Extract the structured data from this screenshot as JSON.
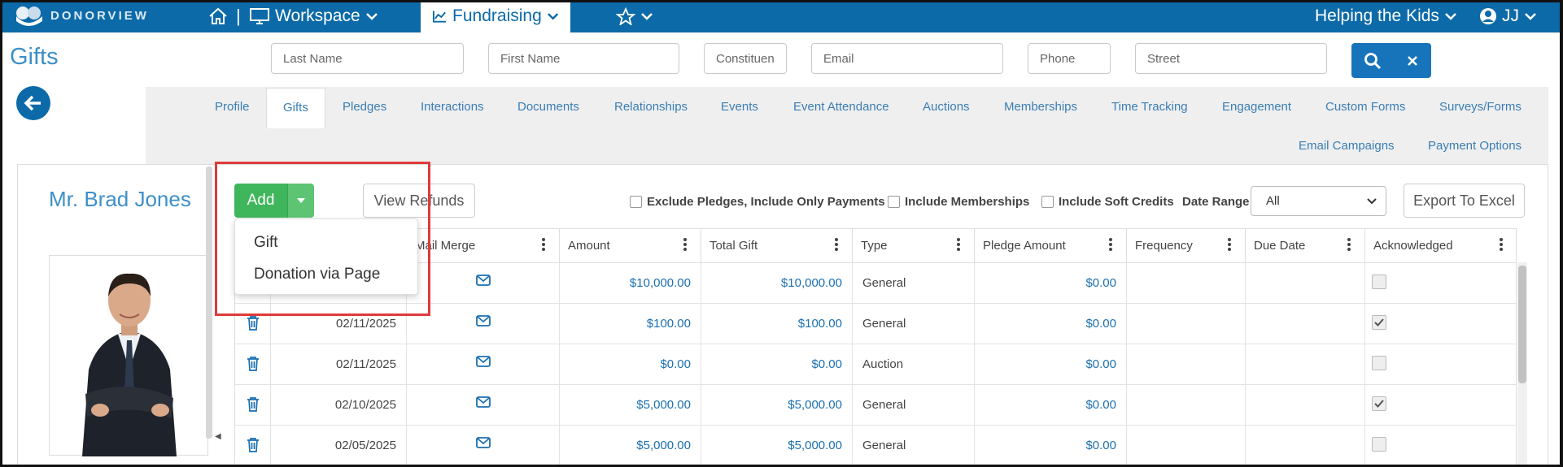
{
  "app": {
    "logo_text": "DONORVIEW"
  },
  "topbar": {
    "workspace_label": "Workspace",
    "fundraising_label": "Fundraising",
    "org_label": "Helping the Kids",
    "user_initials": "JJ",
    "separator": "|"
  },
  "page": {
    "title": "Gifts"
  },
  "search": {
    "last_name": "Last Name",
    "first_name": "First Name",
    "constituent": "Constituen",
    "email": "Email",
    "phone": "Phone",
    "street": "Street"
  },
  "tabs": {
    "profile": "Profile",
    "gifts": "Gifts",
    "pledges": "Pledges",
    "interactions": "Interactions",
    "documents": "Documents",
    "relationships": "Relationships",
    "events": "Events",
    "event_attendance": "Event Attendance",
    "auctions": "Auctions",
    "memberships": "Memberships",
    "time_tracking": "Time Tracking",
    "engagement": "Engagement",
    "custom_forms": "Custom Forms",
    "surveys_forms": "Surveys/Forms",
    "email_campaigns": "Email Campaigns",
    "payment_options": "Payment Options"
  },
  "donor": {
    "name": "Mr. Brad Jones"
  },
  "toolbar": {
    "add_label": "Add",
    "view_refunds": "View Refunds",
    "exclude_pledges": "Exclude Pledges, Include Only Payments",
    "include_memberships": "Include Memberships",
    "include_soft_credits": "Include Soft Credits",
    "date_range_label": "Date Range",
    "date_range_value": "All",
    "export": "Export To Excel"
  },
  "add_menu": {
    "items": [
      "Gift",
      "Donation via Page"
    ]
  },
  "grid": {
    "columns": {
      "mail_merge": "Mail Merge",
      "amount": "Amount",
      "total_gift": "Total Gift",
      "type": "Type",
      "pledge_amount": "Pledge Amount",
      "frequency": "Frequency",
      "due_date": "Due Date",
      "acknowledged": "Acknowledged"
    },
    "rows": [
      {
        "date": "",
        "amount": "$10,000.00",
        "total_gift": "$10,000.00",
        "type": "General",
        "pledge_amount": "$0.00",
        "acknowledged": false
      },
      {
        "date": "02/11/2025",
        "amount": "$100.00",
        "total_gift": "$100.00",
        "type": "General",
        "pledge_amount": "$0.00",
        "acknowledged": true
      },
      {
        "date": "02/11/2025",
        "amount": "$0.00",
        "total_gift": "$0.00",
        "type": "Auction",
        "pledge_amount": "$0.00",
        "acknowledged": false
      },
      {
        "date": "02/10/2025",
        "amount": "$5,000.00",
        "total_gift": "$5,000.00",
        "type": "General",
        "pledge_amount": "$0.00",
        "acknowledged": true
      },
      {
        "date": "02/05/2025",
        "amount": "$5,000.00",
        "total_gift": "$5,000.00",
        "type": "General",
        "pledge_amount": "$0.00",
        "acknowledged": false
      }
    ]
  },
  "colors": {
    "brand_blue": "#0c6aa8",
    "link_blue": "#1a6fb0",
    "add_green": "#3fb65b",
    "highlight_red": "#e03a3a"
  },
  "icons": [
    "home-icon",
    "monitor-icon",
    "chart-icon",
    "star-icon",
    "user-icon",
    "search-icon",
    "close-icon",
    "back-arrow-icon",
    "trash-icon",
    "envelope-icon",
    "kebab-icon",
    "check-icon",
    "chevron-down-icon"
  ]
}
